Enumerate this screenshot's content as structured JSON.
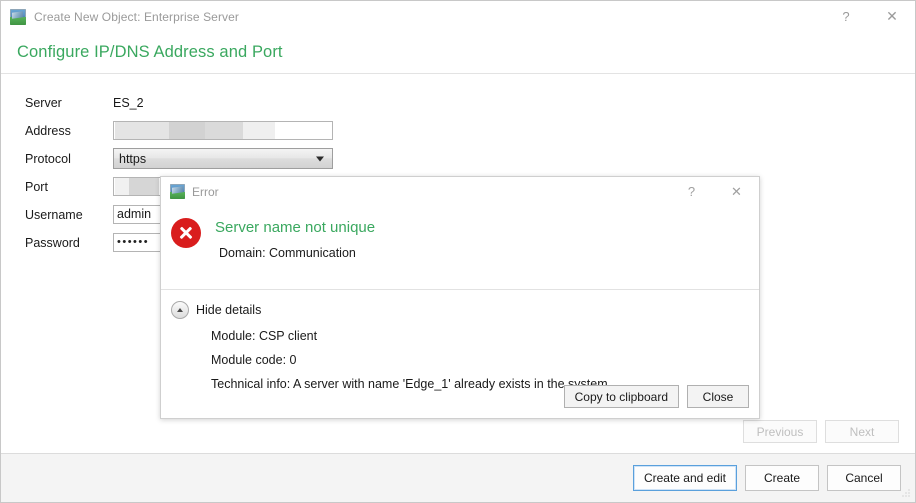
{
  "window": {
    "title": "Create New Object: Enterprise Server",
    "icon": "app-icon",
    "help_label": "?",
    "close_label": "✕"
  },
  "header": {
    "title": "Configure IP/DNS Address and Port",
    "accent_color": "#3aa85f"
  },
  "form": {
    "rows": [
      {
        "label": "Server",
        "type": "static",
        "value": "ES_2"
      },
      {
        "label": "Address",
        "type": "redacted",
        "value": ""
      },
      {
        "label": "Protocol",
        "type": "combo",
        "value": "https"
      },
      {
        "label": "Port",
        "type": "redacted",
        "value": ""
      },
      {
        "label": "Username",
        "type": "text",
        "value": "admin"
      },
      {
        "label": "Password",
        "type": "password",
        "value": "••••••"
      }
    ]
  },
  "nav": {
    "previous_label": "Previous",
    "next_label": "Next",
    "previous_enabled": false,
    "next_enabled": false
  },
  "footer": {
    "create_and_edit_label": "Create and edit",
    "create_label": "Create",
    "cancel_label": "Cancel"
  },
  "error_dialog": {
    "title": "Error",
    "icon": "app-icon",
    "help_label": "?",
    "close_label": "✕",
    "status_icon": "error-circle-x-icon",
    "heading": "Server name not unique",
    "heading_color": "#3aa85f",
    "subtitle": "Domain: Communication",
    "details_toggle_label": "Hide details",
    "details": [
      "Module: CSP client",
      "Module code: 0",
      "Technical info: A server with name 'Edge_1' already exists in the system"
    ],
    "copy_label": "Copy to clipboard",
    "close_button_label": "Close"
  }
}
